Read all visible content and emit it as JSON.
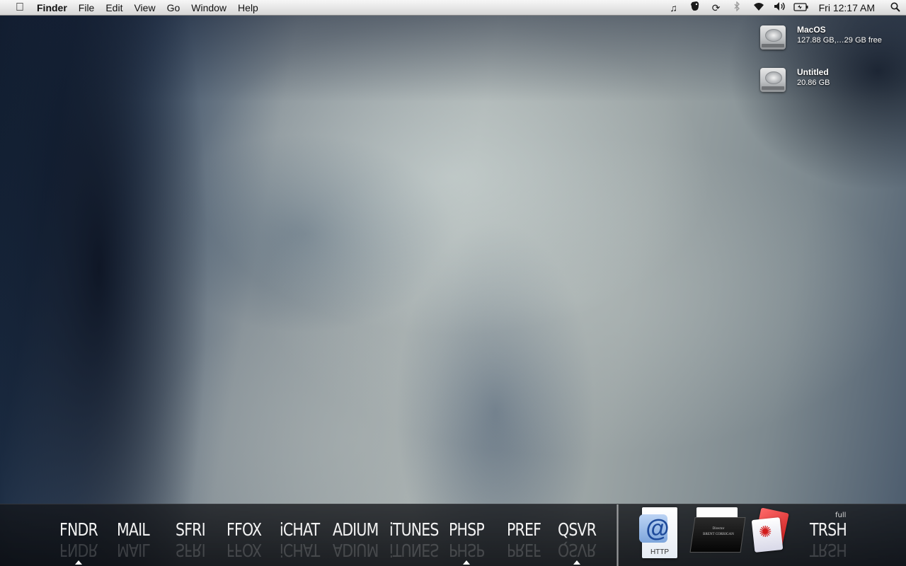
{
  "menubar": {
    "app_name": "Finder",
    "menus": [
      "File",
      "Edit",
      "View",
      "Go",
      "Window",
      "Help"
    ],
    "status_icons": [
      "music-note-icon",
      "evernote-elephant-icon",
      "sync-icon",
      "bluetooth-icon",
      "wifi-icon",
      "volume-icon",
      "battery-icon"
    ],
    "clock": "Fri 12:17 AM"
  },
  "desktop": {
    "drives": [
      {
        "name": "MacOS",
        "info": "127.88 GB,…29 GB free"
      },
      {
        "name": "Untitled",
        "info": "20.86 GB"
      }
    ]
  },
  "dock": {
    "apps": [
      {
        "label": "FNDR",
        "running": true
      },
      {
        "label": "MAIL",
        "running": false
      },
      {
        "label": "SFRI",
        "running": false
      },
      {
        "label": "FFOX",
        "running": false
      },
      {
        "label": "iCHAT",
        "running": false
      },
      {
        "label": "ADIUM",
        "running": false
      },
      {
        "label": "iTUNES",
        "running": false
      },
      {
        "label": "PHSP",
        "running": true
      },
      {
        "label": "PREF",
        "running": false
      },
      {
        "label": "QSVR",
        "running": true
      }
    ],
    "http_doc_label": "HTTP",
    "poster_lines": [
      "Director",
      "BRENT CORRIGAN"
    ],
    "trash_label": "TRSH",
    "trash_status": "full"
  }
}
